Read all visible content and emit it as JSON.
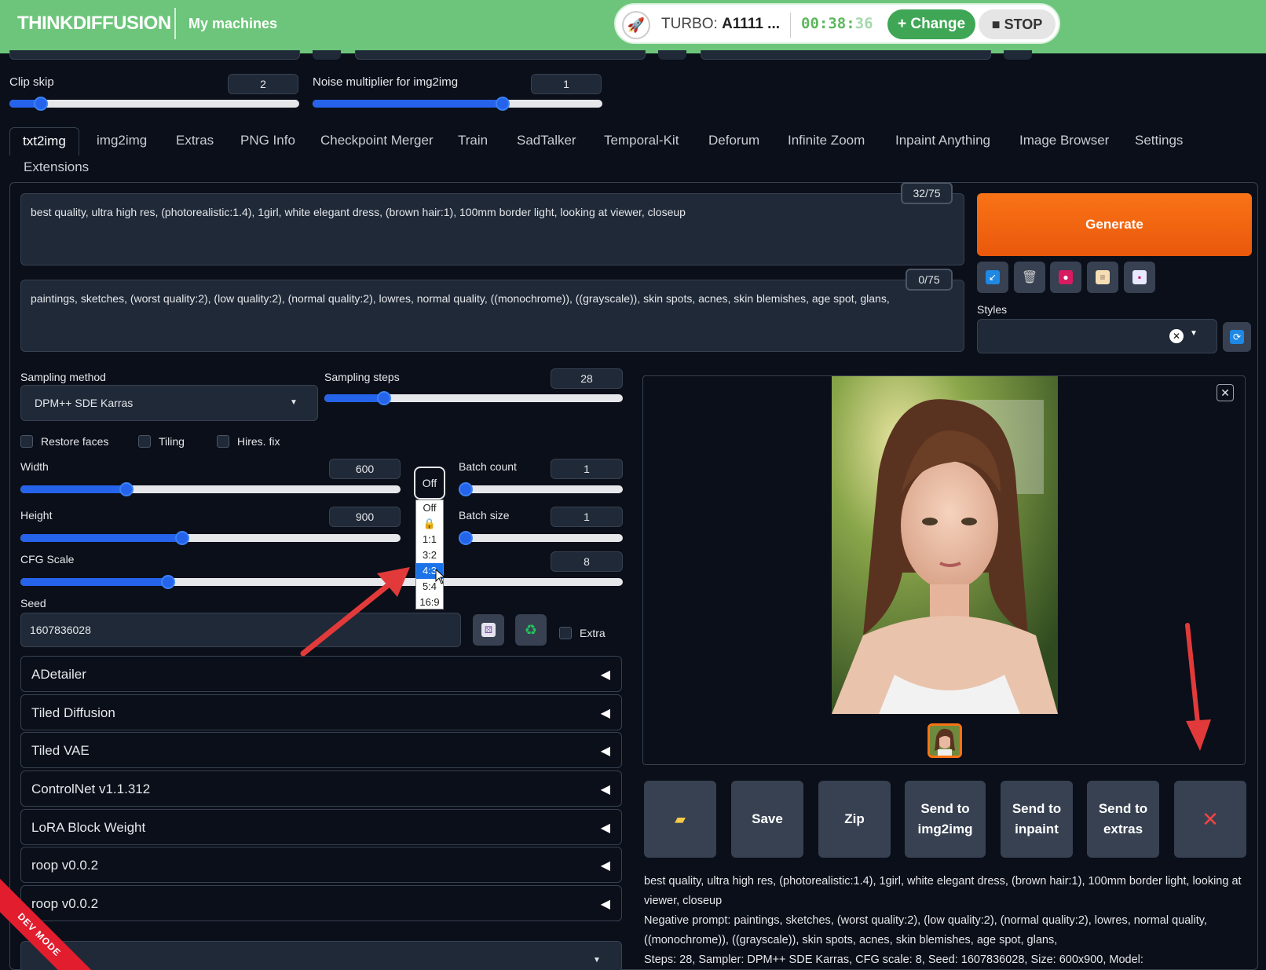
{
  "topbar": {
    "logo": "THINKDIFFUSION",
    "my_machines": "My machines",
    "turbo_prefix": "TURBO:",
    "turbo_value": "A1111 ...",
    "timer_main": "00:38:",
    "timer_dim": "36",
    "change_label": "+ Change",
    "stop_label": "■ STOP"
  },
  "settings": {
    "clip_skip_label": "Clip skip",
    "clip_skip_value": "2",
    "noise_label": "Noise multiplier for img2img",
    "noise_value": "1"
  },
  "tabs": [
    "txt2img",
    "img2img",
    "Extras",
    "PNG Info",
    "Checkpoint Merger",
    "Train",
    "SadTalker",
    "Temporal-Kit",
    "Deforum",
    "Infinite Zoom",
    "Inpaint Anything",
    "Image Browser",
    "Settings",
    "Extensions"
  ],
  "prompt": {
    "positive": "best quality, ultra high res, (photorealistic:1.4), 1girl, white elegant dress, (brown hair:1), 100mm border light, looking at viewer, closeup",
    "positive_count": "32/75",
    "negative": "paintings, sketches, (worst quality:2), (low quality:2), (normal quality:2), lowres, normal quality, ((monochrome)), ((grayscale)), skin spots, acnes, skin blemishes, age spot, glans,",
    "negative_count": "0/75"
  },
  "generate_label": "Generate",
  "styles_label": "Styles",
  "sampling": {
    "method_label": "Sampling method",
    "method_value": "DPM++ SDE Karras",
    "steps_label": "Sampling steps",
    "steps_value": "28"
  },
  "checks": {
    "restore_faces": "Restore faces",
    "tiling": "Tiling",
    "hires_fix": "Hires. fix"
  },
  "dims": {
    "width_label": "Width",
    "width_value": "600",
    "height_label": "Height",
    "height_value": "900",
    "batch_count_label": "Batch count",
    "batch_count_value": "1",
    "batch_size_label": "Batch size",
    "batch_size_value": "1",
    "cfg_label": "CFG Scale",
    "cfg_value": "8"
  },
  "aspect": {
    "button": "Off",
    "options": [
      "Off",
      "🔒",
      "1:1",
      "3:2",
      "4:3",
      "5:4",
      "16:9"
    ],
    "selected": "4:3"
  },
  "seed": {
    "label": "Seed",
    "value": "1607836028",
    "extra_label": "Extra"
  },
  "accordions": [
    "ADetailer",
    "Tiled Diffusion",
    "Tiled VAE",
    "ControlNet v1.1.312",
    "LoRA Block Weight",
    "roop v0.0.2",
    "roop v0.0.2"
  ],
  "script_label": "ipt",
  "actions": {
    "save": "Save",
    "zip": "Zip",
    "send_img2img": "Send to img2img",
    "send_inpaint": "Send to inpaint",
    "send_extras": "Send to extras",
    "delete": "✕"
  },
  "info": {
    "line1": "best quality, ultra high res, (photorealistic:1.4), 1girl, white elegant dress, (brown hair:1), 100mm border light, looking at viewer, closeup",
    "line2": "Negative prompt: paintings, sketches, (worst quality:2), (low quality:2), (normal quality:2), lowres, normal quality, ((monochrome)), ((grayscale)), skin spots, acnes, skin blemishes, age spot, glans,",
    "line3": "Steps: 28, Sampler: DPM++ SDE Karras, CFG scale: 8, Seed: 1607836028, Size: 600x900, Model:"
  },
  "devmode": "DEV MODE",
  "colors": {
    "topbar": "#6cc57a",
    "accent": "#2563eb",
    "generate": "#f97316",
    "annotation_arrow": "#e23a3a"
  }
}
